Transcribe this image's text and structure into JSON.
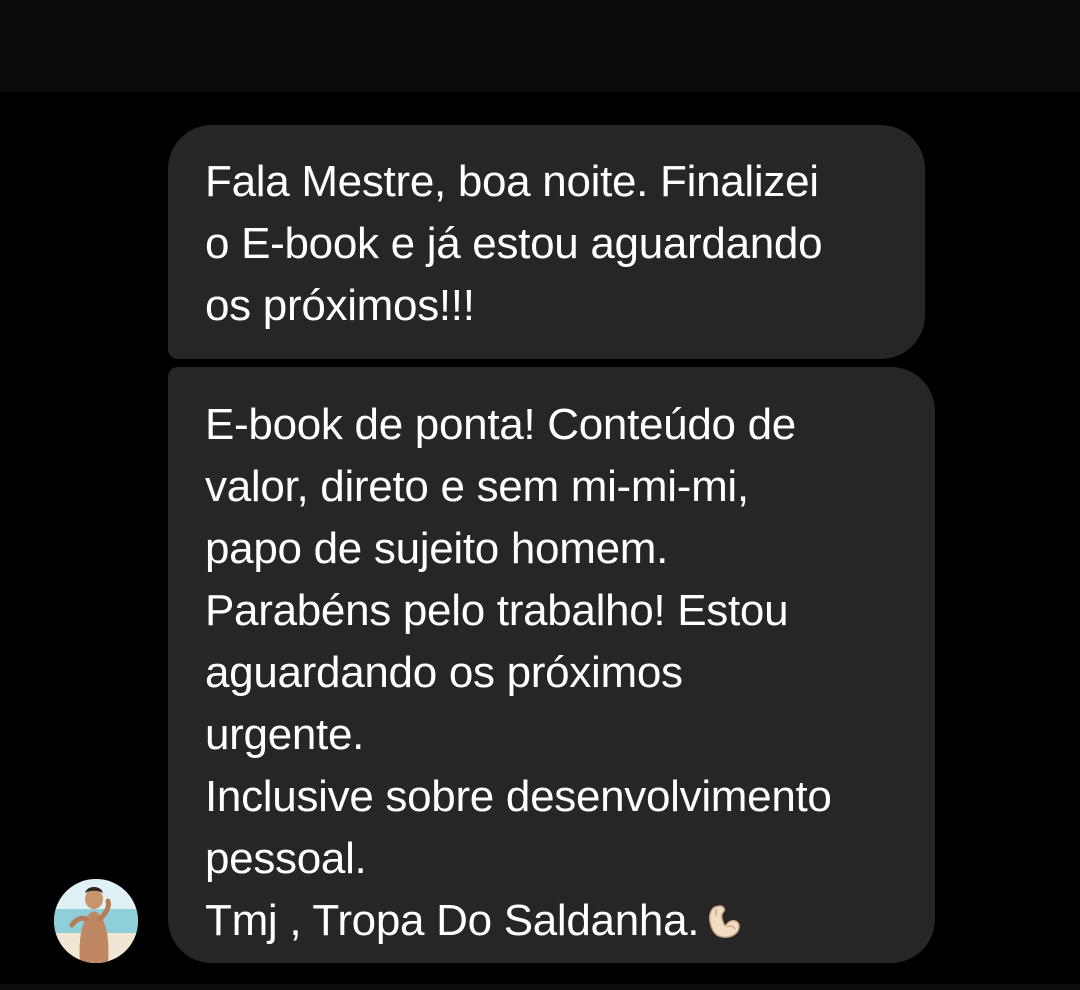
{
  "conversation": {
    "messages": [
      {
        "sender": "other",
        "text": "Fala Mestre, boa noite. Finalizei\no E-book e já estou aguardando\nos próximos!!!"
      },
      {
        "sender": "other",
        "text": "E-book de ponta! Conteúdo de\nvalor, direto e sem mi-mi-mi,\npapo de sujeito homem.\nParabéns pelo trabalho! Estou\naguardando os próximos\nurgente.\nInclusive sobre desenvolvimento\npessoal.\nTmj , Tropa Do Saldanha.",
        "trailing_icon": "flexed-biceps-icon"
      }
    ]
  },
  "colors": {
    "background": "#000000",
    "top_bar": "#0b0b0b",
    "bubble": "#262626",
    "text": "#ffffff"
  }
}
